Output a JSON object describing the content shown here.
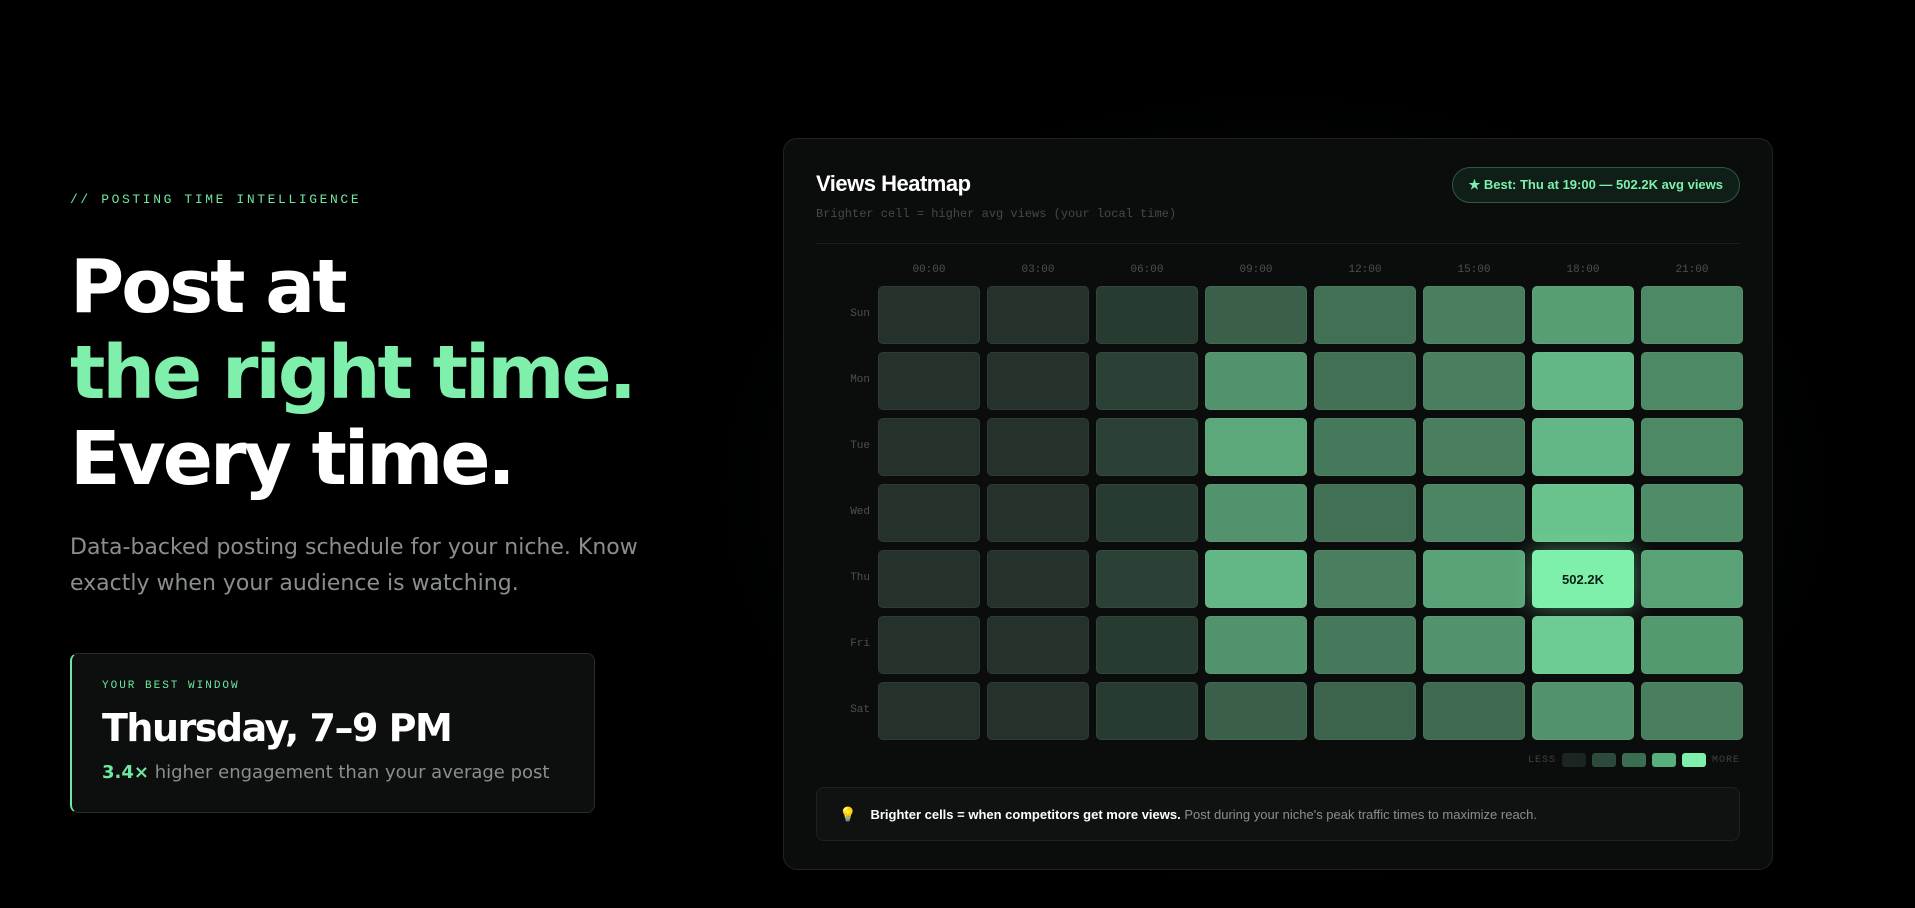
{
  "hero": {
    "eyebrow": "// POSTING TIME INTELLIGENCE",
    "headline_line1": "Post at",
    "headline_line2": "the right time.",
    "headline_line3": "Every time.",
    "subtext": "Data-backed posting schedule for your niche. Know exactly when your audience is watching.",
    "accent_color": "#7ff0ac"
  },
  "best_window": {
    "kicker": "YOUR BEST WINDOW",
    "day_time": "Thursday, 7–9 PM",
    "multiplier": "3.4×",
    "stat_text": " higher engagement than your average post"
  },
  "panel": {
    "title": "Views Heatmap",
    "subtitle": "Brighter cell = higher avg views (your local time)",
    "best_pill": "★ Best: Thu at 19:00 — 502.2K avg views",
    "legend_less": "LESS",
    "legend_more": "MORE",
    "tip_icon": "lightbulb-icon",
    "tip_bold": "Brighter cells = when competitors get more views.",
    "tip_text": "Post during your niche's peak traffic times to maximize reach."
  },
  "chart_data": {
    "type": "heatmap",
    "title": "Views Heatmap",
    "x_categories": [
      "00:00",
      "03:00",
      "06:00",
      "09:00",
      "12:00",
      "15:00",
      "18:00",
      "21:00"
    ],
    "y_categories": [
      "Sun",
      "Mon",
      "Tue",
      "Wed",
      "Thu",
      "Fri",
      "Sat"
    ],
    "intensity": [
      [
        0.08,
        0.08,
        0.12,
        0.3,
        0.38,
        0.45,
        0.6,
        0.5
      ],
      [
        0.08,
        0.08,
        0.15,
        0.55,
        0.38,
        0.45,
        0.72,
        0.5
      ],
      [
        0.08,
        0.08,
        0.15,
        0.65,
        0.42,
        0.45,
        0.72,
        0.5
      ],
      [
        0.08,
        0.08,
        0.12,
        0.55,
        0.38,
        0.48,
        0.78,
        0.52
      ],
      [
        0.08,
        0.08,
        0.15,
        0.72,
        0.45,
        0.62,
        1.0,
        0.62
      ],
      [
        0.08,
        0.08,
        0.12,
        0.55,
        0.42,
        0.55,
        0.82,
        0.58
      ],
      [
        0.08,
        0.08,
        0.12,
        0.3,
        0.32,
        0.35,
        0.55,
        0.45
      ]
    ],
    "best_cell": {
      "day": "Thu",
      "hour": "18:00",
      "label": "502.2K"
    },
    "legend_colors": [
      "#1c2522",
      "#2b4a3b",
      "#3b6d52",
      "#57b07c",
      "#7ff0ac"
    ],
    "color_low": "#1c2220",
    "color_high": "#7ff0ac"
  }
}
